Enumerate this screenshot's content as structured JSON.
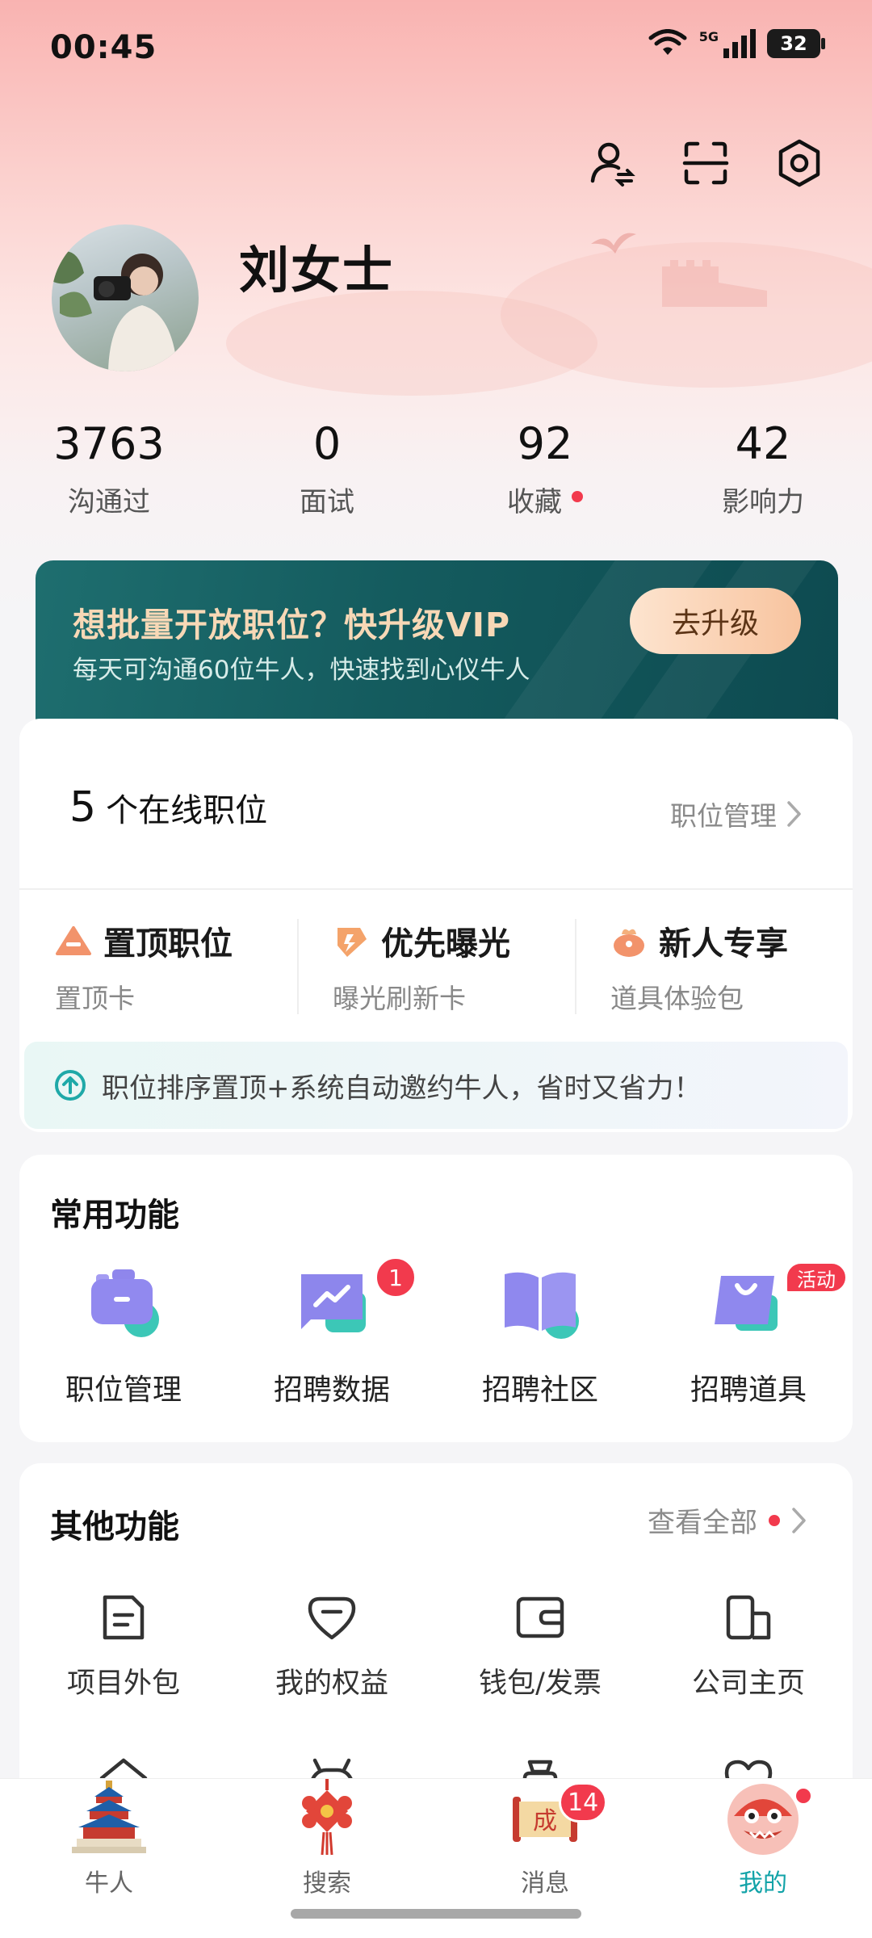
{
  "status_bar": {
    "time": "00:45",
    "network": "5G",
    "battery": "32"
  },
  "profile": {
    "name": "刘女士"
  },
  "stats": [
    {
      "value": "3763",
      "label": "沟通过"
    },
    {
      "value": "0",
      "label": "面试"
    },
    {
      "value": "92",
      "label": "收藏"
    },
    {
      "value": "42",
      "label": "影响力"
    }
  ],
  "vip": {
    "title": "想批量开放职位？快升级VIP",
    "subtitle": "每天可沟通60位牛人，快速找到心仪牛人",
    "button": "去升级"
  },
  "positions": {
    "count": "5",
    "count_label": "个在线职位",
    "manage": "职位管理"
  },
  "perks": [
    {
      "title": "置顶职位",
      "sub": "置顶卡",
      "icon": "pin-top-icon"
    },
    {
      "title": "优先曝光",
      "sub": "曝光刷新卡",
      "icon": "exposure-icon"
    },
    {
      "title": "新人专享",
      "sub": "道具体验包",
      "icon": "gift-bag-icon"
    }
  ],
  "tip": "职位排序置顶+系统自动邀约牛人，省时又省力！",
  "common": {
    "title": "常用功能",
    "items": [
      {
        "label": "职位管理",
        "icon": "briefcase-icon"
      },
      {
        "label": "招聘数据",
        "icon": "data-chart-icon",
        "badge": "1"
      },
      {
        "label": "招聘社区",
        "icon": "community-book-icon"
      },
      {
        "label": "招聘道具",
        "icon": "shopping-bag-icon",
        "tag": "活动"
      }
    ]
  },
  "other": {
    "title": "其他功能",
    "view_all": "查看全部",
    "items": [
      {
        "label": "项目外包",
        "icon": "document-icon"
      },
      {
        "label": "我的权益",
        "icon": "rights-icon"
      },
      {
        "label": "钱包/发票",
        "icon": "wallet-icon"
      },
      {
        "label": "公司主页",
        "icon": "company-icon"
      }
    ]
  },
  "nav": [
    {
      "label": "牛人",
      "icon": "temple-icon"
    },
    {
      "label": "搜索",
      "icon": "chinese-knot-icon"
    },
    {
      "label": "消息",
      "icon": "scroll-icon",
      "badge": "14"
    },
    {
      "label": "我的",
      "icon": "lion-dance-icon",
      "active": true
    }
  ],
  "colors": {
    "accent": "#12a3a8",
    "badge": "#f23a4d",
    "vip_bg": "#145b5e",
    "vip_gold": "#f7d8b6"
  }
}
